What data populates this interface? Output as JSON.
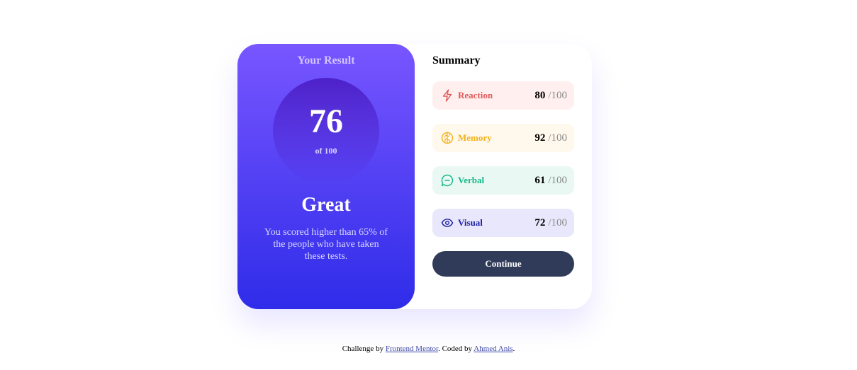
{
  "result": {
    "title": "Your Result",
    "score": "76",
    "score_max_text": "of 100",
    "grade": "Great",
    "description": "You scored higher than 65% of the people who have taken these tests."
  },
  "summary": {
    "title": "Summary",
    "items": [
      {
        "label": "Reaction",
        "score": "80",
        "max": "/100",
        "icon": "lightning-icon",
        "color": "#e05a5a",
        "background": "#fff0ef"
      },
      {
        "label": "Memory",
        "score": "92",
        "max": "/100",
        "icon": "brain-icon",
        "color": "#f3b21b",
        "background": "#fff8ed"
      },
      {
        "label": "Verbal",
        "score": "61",
        "max": "/100",
        "icon": "speech-bubble-icon",
        "color": "#19b78a",
        "background": "#e9f8f3"
      },
      {
        "label": "Visual",
        "score": "72",
        "max": "/100",
        "icon": "eye-icon",
        "color": "#1d20a3",
        "background": "#e8e7fb"
      }
    ],
    "continue_label": "Continue"
  },
  "attribution": {
    "prefix": "Challenge by",
    "link1": "Frontend Mentor",
    "middle": ". Coded by",
    "link2": "Ahmed Anis",
    "suffix": "."
  },
  "colors": {
    "gradient_top": "#7856ff",
    "gradient_bottom": "#2f2ce9",
    "button": "#303b59"
  }
}
